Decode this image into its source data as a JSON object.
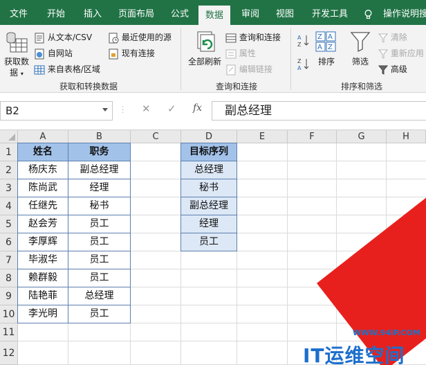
{
  "ribbon_tabs": [
    "文件",
    "开始",
    "插入",
    "页面布局",
    "公式",
    "数据",
    "审阅",
    "视图",
    "开发工具"
  ],
  "active_tab": "数据",
  "tell_me": "操作说明搜",
  "ribbon": {
    "get_data_line1": "获取数",
    "get_data_line2": "据",
    "from_text_csv": "从文本/CSV",
    "from_web": "自网站",
    "from_table": "来自表格/区域",
    "recent_sources": "最近使用的源",
    "existing_connections": "现有连接",
    "group_get_transform": "获取和转换数据",
    "refresh_all": "全部刷新",
    "queries_connections": "查询和连接",
    "properties": "属性",
    "edit_links": "编辑链接",
    "group_queries": "查询和连接",
    "sort": "排序",
    "filter": "筛选",
    "clear": "清除",
    "reapply": "重新应用",
    "advanced": "高级",
    "group_sort_filter": "排序和筛选"
  },
  "formula_bar": {
    "name_box": "B2",
    "fx": "fx",
    "content": "副总经理"
  },
  "columns": [
    "A",
    "B",
    "C",
    "D",
    "E",
    "F",
    "G",
    "H"
  ],
  "rows": [
    "1",
    "2",
    "3",
    "4",
    "5",
    "6",
    "7",
    "8",
    "9",
    "10",
    "11",
    "12"
  ],
  "table1": {
    "headers": [
      "姓名",
      "职务"
    ],
    "rows": [
      [
        "杨庆东",
        "副总经理"
      ],
      [
        "陈尚武",
        "经理"
      ],
      [
        "任继先",
        "秘书"
      ],
      [
        "赵会芳",
        "员工"
      ],
      [
        "李厚辉",
        "员工"
      ],
      [
        "毕淑华",
        "员工"
      ],
      [
        "赖群毅",
        "员工"
      ],
      [
        "陆艳菲",
        "总经理"
      ],
      [
        "李光明",
        "员工"
      ]
    ]
  },
  "table2": {
    "header": "目标序列",
    "rows": [
      "总经理",
      "秘书",
      "副总经理",
      "经理",
      "员工"
    ]
  },
  "watermark": {
    "url": "WWW.94IP.COM",
    "brand": "IT运维空间"
  },
  "colors": {
    "excel_green": "#217346",
    "header_fill": "#a3c2ea",
    "target_fill": "#dde8f6",
    "border": "#5b7fae",
    "watermark_red": "#e8201d",
    "watermark_blue": "#1d6fcc"
  }
}
